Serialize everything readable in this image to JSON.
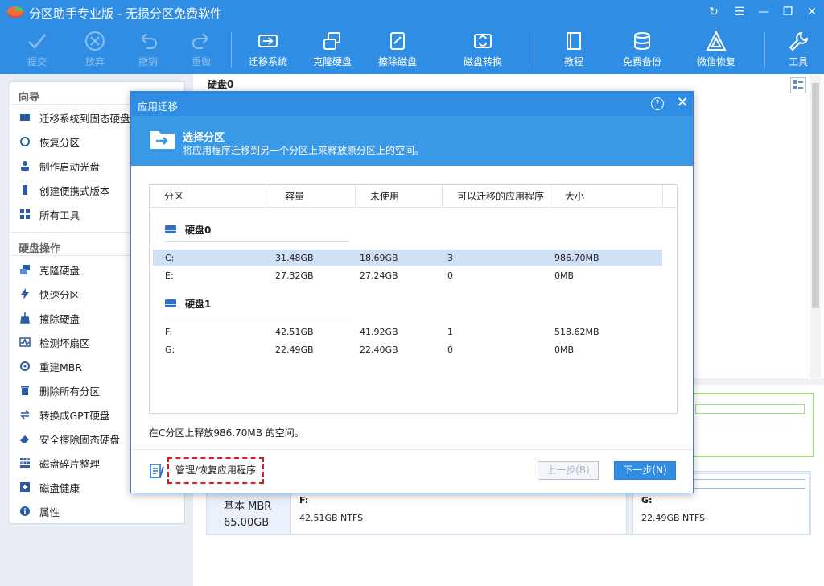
{
  "app": {
    "title": "分区助手专业版 - 无损分区免费软件"
  },
  "window_controls": {
    "refresh": "↻",
    "menu": "☰",
    "minimize": "—",
    "restore": "❐",
    "close": "✕"
  },
  "toolbar": {
    "submit": "提交",
    "discard": "放弃",
    "undo": "撤销",
    "redo": "重做",
    "migrate_os": "迁移系统",
    "clone_disk": "克隆硬盘",
    "wipe_disk": "擦除磁盘",
    "disk_convert": "磁盘转换",
    "tutorial": "教程",
    "free_backup": "免费备份",
    "wechat_recovery": "微信恢复",
    "tools": "工具"
  },
  "sidebar": {
    "wizard_title": "向导",
    "wizard_items": [
      "迁移系统到固态硬盘",
      "恢复分区",
      "制作启动光盘",
      "创建便携式版本",
      "所有工具"
    ],
    "disk_ops_title": "硬盘操作",
    "disk_ops_items": [
      "克隆硬盘",
      "快速分区",
      "擦除硬盘",
      "检测坏扇区",
      "重建MBR",
      "删除所有分区",
      "转换成GPT硬盘",
      "安全擦除固态硬盘",
      "磁盘碎片整理",
      "磁盘健康",
      "属性"
    ]
  },
  "main": {
    "disk0_label": "硬盘0",
    "disk1_type": "基本 MBR",
    "disk1_size": "65.00GB",
    "partitions": [
      {
        "name": "F:",
        "size": "42.51GB NTFS"
      },
      {
        "name": "G:",
        "size": "22.49GB NTFS"
      }
    ]
  },
  "dialog": {
    "title": "应用迁移",
    "help": "?",
    "close": "✕",
    "header_title": "选择分区",
    "header_sub": "将应用程序迁移到另一个分区上来释放原分区上的空间。",
    "columns": [
      "分区",
      "容量",
      "未使用",
      "可以迁移的应用程序",
      "大小"
    ],
    "groups": [
      {
        "name": "硬盘0",
        "rows": [
          {
            "part": "C:",
            "cap": "31.48GB",
            "free": "18.69GB",
            "apps": "3",
            "size": "986.70MB",
            "selected": true
          },
          {
            "part": "E:",
            "cap": "27.32GB",
            "free": "27.24GB",
            "apps": "0",
            "size": "0MB",
            "selected": false
          }
        ]
      },
      {
        "name": "硬盘1",
        "rows": [
          {
            "part": "F:",
            "cap": "42.51GB",
            "free": "41.92GB",
            "apps": "1",
            "size": "518.62MB",
            "selected": false
          },
          {
            "part": "G:",
            "cap": "22.49GB",
            "free": "22.40GB",
            "apps": "0",
            "size": "0MB",
            "selected": false
          }
        ]
      }
    ],
    "note": "在C分区上释放986.70MB 的空间。",
    "manage_link": "管理/恢复应用程序",
    "prev_button": "上一步(B)",
    "next_button": "下一步(N)"
  },
  "colors": {
    "accent": "#2f8de4",
    "header": "#3b9ae8",
    "selection": "#cfe0f7",
    "highlight": "#e31a1a"
  }
}
